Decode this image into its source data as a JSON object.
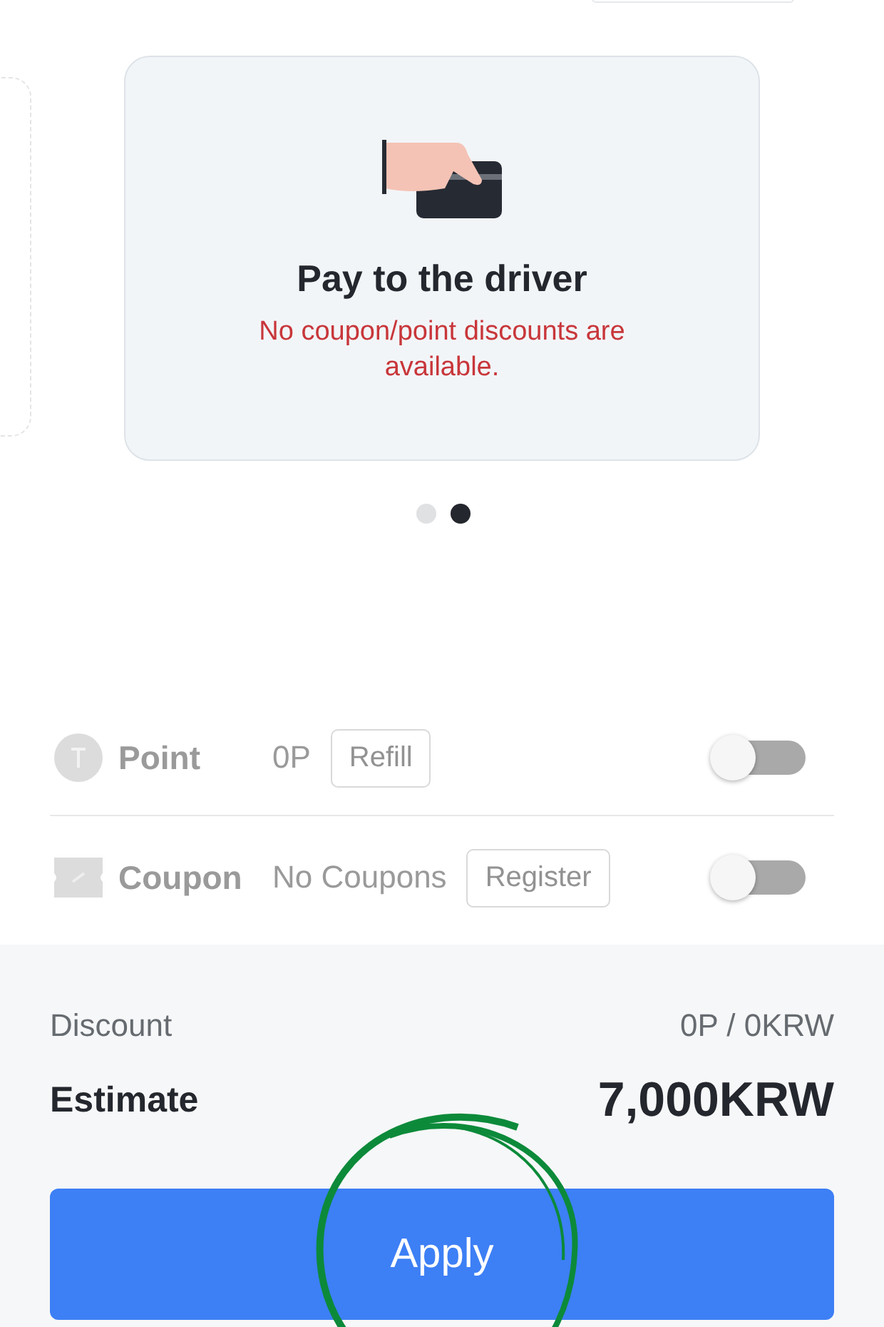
{
  "payment_card": {
    "title": "Pay to the driver",
    "notice": "No coupon/point discounts are available."
  },
  "pager": [
    {
      "selected": false
    },
    {
      "selected": true
    }
  ],
  "options": [
    {
      "kind": "point",
      "label": "Point",
      "value": "0P",
      "action": "Refill",
      "on": false
    },
    {
      "kind": "coupon",
      "label": "Coupon",
      "value": "No Coupons",
      "action": "Register",
      "on": false
    }
  ],
  "summary": {
    "discount_label": "Discount",
    "discount_value": "0P / 0KRW",
    "estimate_label": "Estimate",
    "estimate_value": "7,000KRW"
  },
  "apply_button": "Apply"
}
